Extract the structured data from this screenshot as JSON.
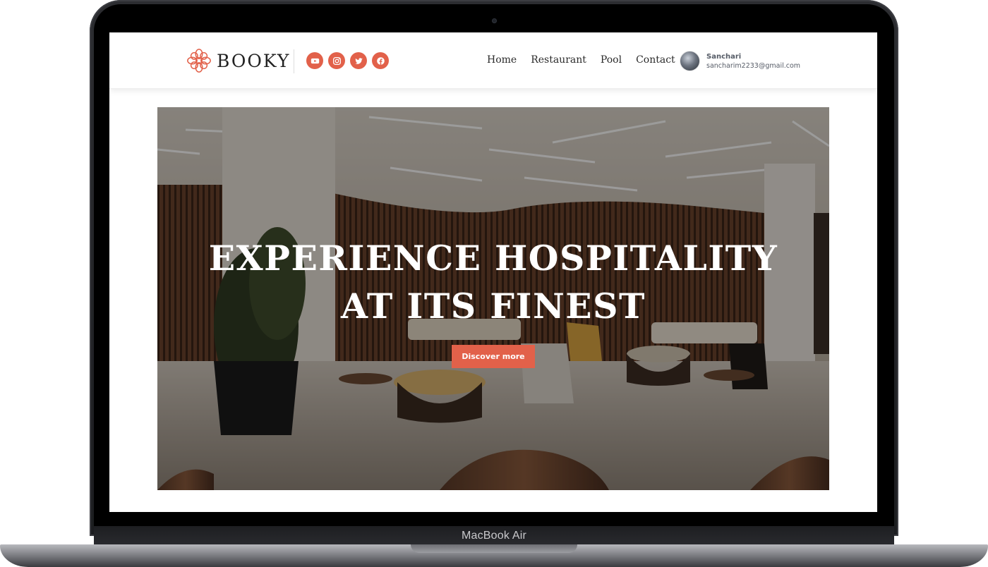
{
  "device": {
    "label": "MacBook Air"
  },
  "header": {
    "brand": "BOOKY",
    "socials": [
      {
        "icon": "youtube-icon",
        "label": "YouTube"
      },
      {
        "icon": "instagram-icon",
        "label": "Instagram"
      },
      {
        "icon": "twitter-icon",
        "label": "Twitter"
      },
      {
        "icon": "facebook-icon",
        "label": "Facebook"
      }
    ],
    "nav": [
      {
        "label": "Home"
      },
      {
        "label": "Restaurant"
      },
      {
        "label": "Pool"
      },
      {
        "label": "Contact"
      }
    ],
    "user": {
      "name": "Sanchari",
      "email": "sancharim2233@gmail.com"
    }
  },
  "hero": {
    "title_line1": "EXPERIENCE HOSPITALITY",
    "title_line2": "AT ITS FINEST",
    "cta_label": "Discover more"
  },
  "colors": {
    "accent": "#e2614a",
    "text_dark": "#222222",
    "hero_text": "#ffffff"
  }
}
